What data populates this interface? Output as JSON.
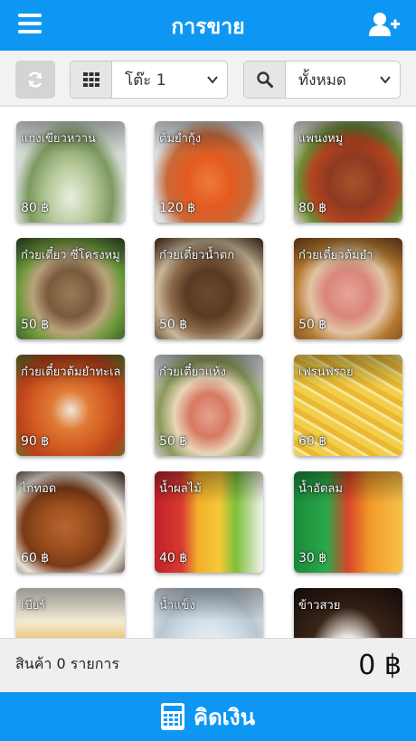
{
  "header": {
    "title": "การขาย",
    "menu_icon": "hamburger-menu-icon",
    "add_user_icon": "user-plus-icon"
  },
  "toolbar": {
    "refresh_icon": "refresh-icon",
    "table_icon": "grid-icon",
    "table_value": "โต๊ะ 1",
    "search_icon": "search-icon",
    "filter_value": "ทั้งหมด"
  },
  "menu_items": [
    {
      "name": "แกงเขียวหวาน",
      "price": "80 ฿"
    },
    {
      "name": "ต้มยำกุ้ง",
      "price": "120 ฿"
    },
    {
      "name": "แพนงหมู",
      "price": "80 ฿"
    },
    {
      "name": "ก๋วยเตี๋ยว ซี่โครงหมู",
      "price": "50 ฿"
    },
    {
      "name": "ก๋วยเตี๋ยวน้ำตก",
      "price": "50 ฿"
    },
    {
      "name": "ก๋วยเตี๋ยวต้มยำ",
      "price": "50 ฿"
    },
    {
      "name": "ก๋วยเตี๋ยวต้มยำทะเล",
      "price": "90 ฿"
    },
    {
      "name": "ก๋วยเตี๋ยวแห้ง",
      "price": "50 ฿"
    },
    {
      "name": "เฟรนฟราย",
      "price": "60 ฿"
    },
    {
      "name": "ไก่ทอด",
      "price": "60 ฿"
    },
    {
      "name": "น้ำผลไม้",
      "price": "40 ฿"
    },
    {
      "name": "น้ำอัดลม",
      "price": "30 ฿"
    },
    {
      "name": "เบียร์",
      "price": ""
    },
    {
      "name": "น้ำแข็ง",
      "price": ""
    },
    {
      "name": "ข้าวสวย",
      "price": ""
    }
  ],
  "summary": {
    "count_label": "สินค้า 0 รายการ",
    "total": "0 ฿"
  },
  "checkout": {
    "label": "คิดเงิน",
    "icon": "calculator-icon"
  },
  "colors": {
    "primary": "#0d97f2"
  }
}
